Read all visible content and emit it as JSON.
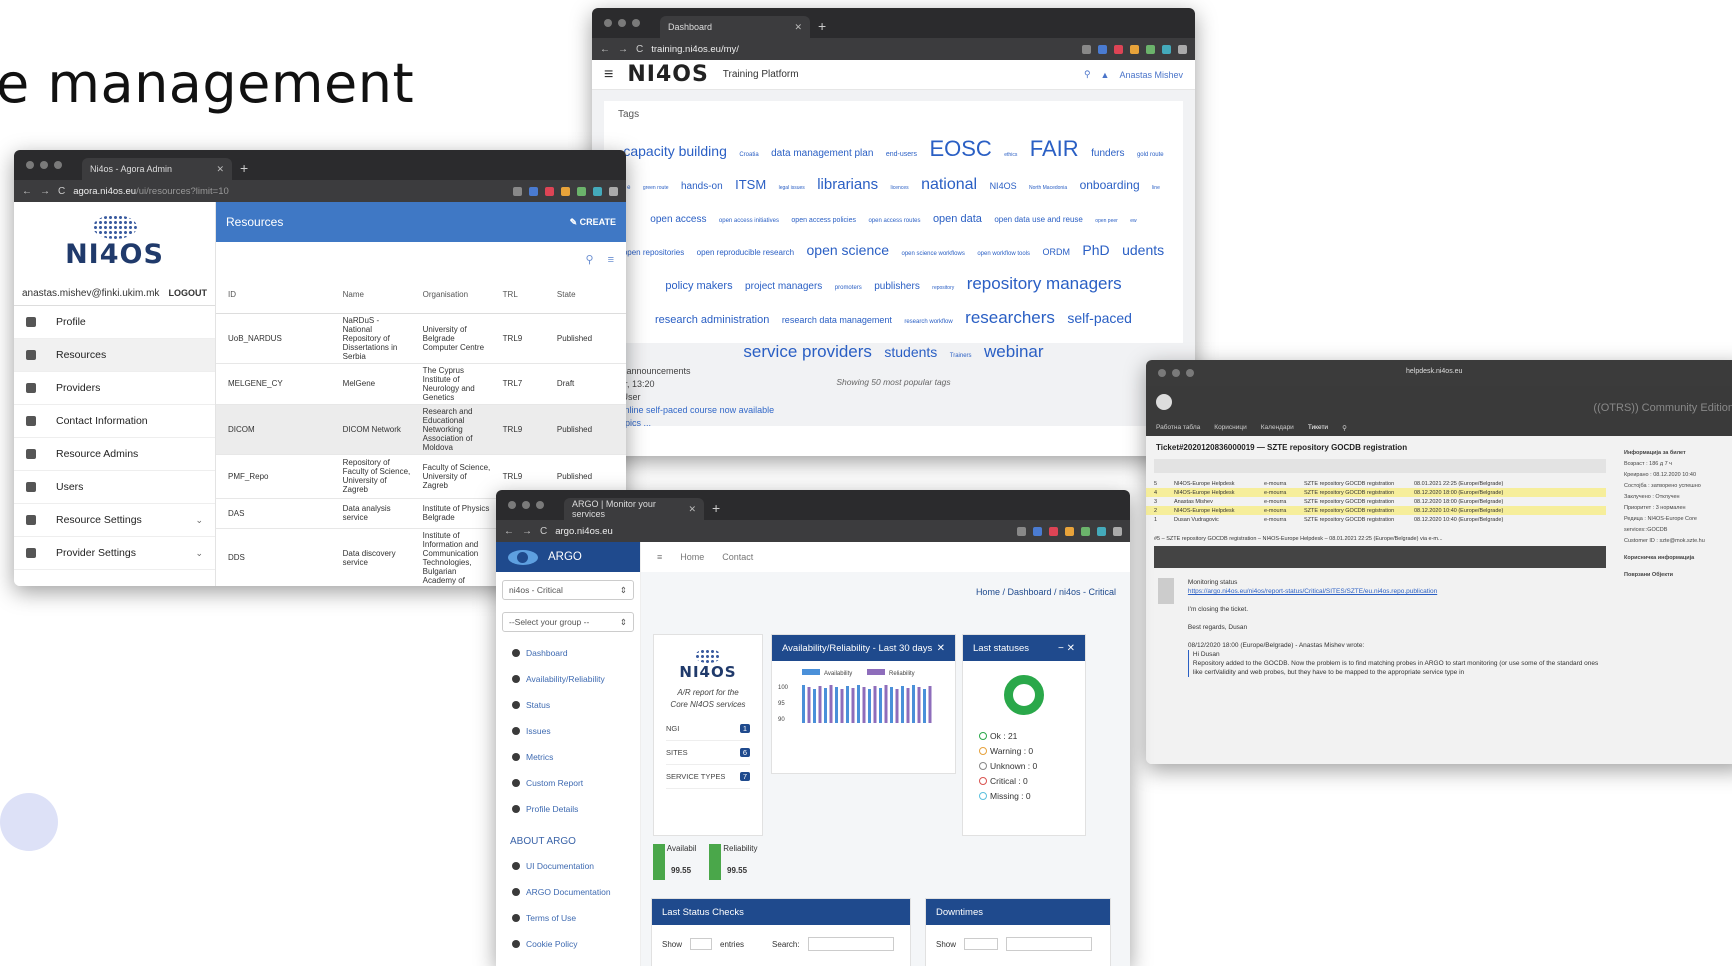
{
  "slide": {
    "title": "e management"
  },
  "agora": {
    "tab": "Ni4os - Agora Admin",
    "url_host": "agora.ni4os.eu",
    "url_path": "/ui/resources?limit=10",
    "logo": "NI4OS",
    "user": "anastas.mishev@finki.ukim.mk",
    "logout": "LOGOUT",
    "menu": [
      "Profile",
      "Resources",
      "Providers",
      "Contact Information",
      "Resource Admins",
      "Users",
      "Resource Settings",
      "Provider Settings"
    ],
    "header": "Resources",
    "create": "CREATE",
    "columns": [
      "ID",
      "Name",
      "Organisation",
      "TRL",
      "State"
    ],
    "rows": [
      [
        "UoB_NARDUS",
        "NaRDuS - National Repository of Dissertations in Serbia",
        "University of Belgrade Computer Centre",
        "TRL9",
        "Published"
      ],
      [
        "MELGENE_CY",
        "MelGene",
        "The Cyprus Institute of Neurology and Genetics",
        "TRL7",
        "Draft"
      ],
      [
        "DICOM",
        "DICOM Network",
        "Research and Educational Networking Association of Moldova",
        "TRL9",
        "Published"
      ],
      [
        "PMF_Repo",
        "Repository of Faculty of Science, University of Zagreb",
        "Faculty of Science, University of Zagreb",
        "TRL9",
        "Published"
      ],
      [
        "DAS",
        "Data analysis service",
        "Institute of Physics Belgrade",
        "TRL",
        ""
      ],
      [
        "DDS",
        "Data discovery service",
        "Institute of Information and Communication Technologies, Bulgarian Academy of",
        "",
        ""
      ]
    ]
  },
  "training": {
    "tab": "Dashboard",
    "url": "training.ni4os.eu/my/",
    "logo": "NI4OS",
    "subtitle": "Training Platform",
    "user": "Anastas Mishev",
    "tags_title": "Tags",
    "tags": [
      {
        "t": "capacity building",
        "s": 14
      },
      {
        "t": "Croatia",
        "s": 6
      },
      {
        "t": "data management plan",
        "s": 10
      },
      {
        "t": "end-users",
        "s": 7
      },
      {
        "t": "EOSC",
        "s": 22
      },
      {
        "t": "ethics",
        "s": 5
      },
      {
        "t": "FAIR",
        "s": 22
      },
      {
        "t": "funders",
        "s": 10
      },
      {
        "t": "gold route",
        "s": 6
      },
      {
        "t": "e",
        "s": 6
      },
      {
        "t": "green route",
        "s": 5
      },
      {
        "t": "hands-on",
        "s": 10
      },
      {
        "t": "ITSM",
        "s": 13
      },
      {
        "t": "legal issues",
        "s": 5
      },
      {
        "t": "librarians",
        "s": 15
      },
      {
        "t": "licences",
        "s": 5
      },
      {
        "t": "national",
        "s": 16
      },
      {
        "t": "NI4OS",
        "s": 9
      },
      {
        "t": "North Macedonia",
        "s": 5
      },
      {
        "t": "onboarding",
        "s": 12
      },
      {
        "t": "line",
        "s": 5
      },
      {
        "t": "open access",
        "s": 10
      },
      {
        "t": "open access initiatives",
        "s": 6
      },
      {
        "t": "open access policies",
        "s": 7
      },
      {
        "t": "open access routes",
        "s": 6
      },
      {
        "t": "open data",
        "s": 11
      },
      {
        "t": "open data use and reuse",
        "s": 8
      },
      {
        "t": "open peer",
        "s": 5
      },
      {
        "t": "ew",
        "s": 5
      },
      {
        "t": "open repositories",
        "s": 8
      },
      {
        "t": "open reproducible research",
        "s": 8
      },
      {
        "t": "open science",
        "s": 14
      },
      {
        "t": "open science workflows",
        "s": 6
      },
      {
        "t": "open workflow tools",
        "s": 6
      },
      {
        "t": "ORDM",
        "s": 9
      },
      {
        "t": "PhD",
        "s": 14
      },
      {
        "t": "udents",
        "s": 14
      },
      {
        "t": "policy makers",
        "s": 11
      },
      {
        "t": "project managers",
        "s": 10
      },
      {
        "t": "promoters",
        "s": 6
      },
      {
        "t": "publishers",
        "s": 10
      },
      {
        "t": "repository",
        "s": 5
      },
      {
        "t": "repository managers",
        "s": 17
      },
      {
        "t": "research administration",
        "s": 11
      },
      {
        "t": "research data management",
        "s": 9
      },
      {
        "t": "research workflow",
        "s": 6
      },
      {
        "t": "researchers",
        "s": 17
      },
      {
        "t": "self-paced",
        "s": 14
      },
      {
        "t": "service providers",
        "s": 17
      },
      {
        "t": "students",
        "s": 14
      },
      {
        "t": "Trainers",
        "s": 6
      },
      {
        "t": "webinar",
        "s": 17
      }
    ],
    "footer": "Showing 50 most popular tags",
    "ann_title": "est announcements",
    "ann_date": "Mar, 13:20",
    "ann_user": "in User",
    "ann_link": "4 online self-paced course now available",
    "ann_more": "r topics ..."
  },
  "argo": {
    "tab": "ARGO | Monitor your services",
    "url": "argo.ni4os.eu",
    "logo": "ARGO",
    "select1": "ni4os - Critical",
    "select2": "--Select your group --",
    "menu": [
      "Dashboard",
      "Availability/Reliability",
      "Status",
      "Issues",
      "Metrics",
      "Custom Report",
      "Profile Details"
    ],
    "about_title": "ABOUT ARGO",
    "about": [
      "UI Documentation",
      "ARGO Documentation",
      "Terms of Use",
      "Cookie Policy"
    ],
    "top": [
      "Home",
      "Contact"
    ],
    "crumb": "Home / Dashboard / ni4os - Critical",
    "report_logo": "NI4OS",
    "report_text": "A/R report for the Core NI4OS services",
    "counts": [
      {
        "label": "NGI",
        "value": "1"
      },
      {
        "label": "SITES",
        "value": "6"
      },
      {
        "label": "SERVICE TYPES",
        "value": "7"
      }
    ],
    "ar_title": "Availability/Reliability - Last 30 days",
    "ar_legend": [
      "Availability",
      "Reliability"
    ],
    "ar_y": [
      "100",
      "95",
      "90"
    ],
    "statuses_title": "Last statuses",
    "statuses": [
      "Ok : 21",
      "Warning : 0",
      "Unknown : 0",
      "Critical : 0",
      "Missing : 0"
    ],
    "avail_label": "Availabil",
    "avail": "99.55",
    "rel_label": "Reliability",
    "rel": "99.55",
    "checks_title": "Last Status Checks",
    "show": "Show",
    "entries": "entries",
    "search": "Search:",
    "downtimes_title": "Downtimes",
    "colors": {
      "accent": "#1f4a8d"
    }
  },
  "otrs": {
    "url": "helpdesk.ni4os.eu",
    "brand": "((OTRS)) Community Edition",
    "ticket": "Ticket#2020120836000019 — SZTE repository GOCDB registration",
    "rows": [
      [
        "5",
        "NI4OS-Europe Helpdesk",
        "e-mourra",
        "SZTE repository GOCDB registration",
        "08.01.2021 22:25 (Europe/Belgrade)"
      ],
      [
        "4",
        "NI4OS-Europe Helpdesk",
        "e-mourra",
        "SZTE repository GOCDB registration",
        "08.12.2020 18:00 (Europe/Belgrade)"
      ],
      [
        "3",
        "Anastas Mishev",
        "e-mourra",
        "SZTE repository GOCDB registration",
        "08.12.2020 18:00 (Europe/Belgrade)"
      ],
      [
        "2",
        "NI4OS-Europe Helpdesk",
        "e-mourra",
        "SZTE repository GOCDB registration",
        "08.12.2020 10:40 (Europe/Belgrade)"
      ],
      [
        "1",
        "Dusan Vudragovic",
        "e-mourra",
        "SZTE repository GOCDB registration",
        "08.12.2020 10:40 (Europe/Belgrade)"
      ]
    ],
    "article_head": "#5 – SZTE repository GOCDB registration – NI4OS-Europe Helpdesk – 08.01.2021 22:25 (Europe/Belgrade) via e-m...",
    "msg1": "Monitoring status",
    "msg_link": "https://argo.ni4os.eu/ni4os/report-status/Critical/SITES/SZTE/eu.ni4os.repo.publication",
    "msg2": "I'm closing the ticket.",
    "msg3": "Best regards, Dusan",
    "msg4": "08/12/2020 18:00 (Europe/Belgrade) - Anastas Mishev wrote:",
    "msg5": "Hi Dusan",
    "msg6": "Repository added to the GOCDB. Now the problem is to find matching probes in ARGO to start monitoring (or use some of the standard ones like certValidity and web probes, but they have to be mapped to the appropriate service type in",
    "side": [
      "Информација за билет",
      "Возраст : 186 д 7 ч",
      "Креирано : 08.12.2020 10:40",
      "Состојба : затворено успешно",
      "Заклучено : Отклучен",
      "Приоритет : 3 нормален",
      "Редица : NI4OS-Europe Core services::GOCDB",
      "Customer ID : szte@mok.szte.hu",
      "Корисничка информација",
      "Поврзани Објекти"
    ]
  }
}
